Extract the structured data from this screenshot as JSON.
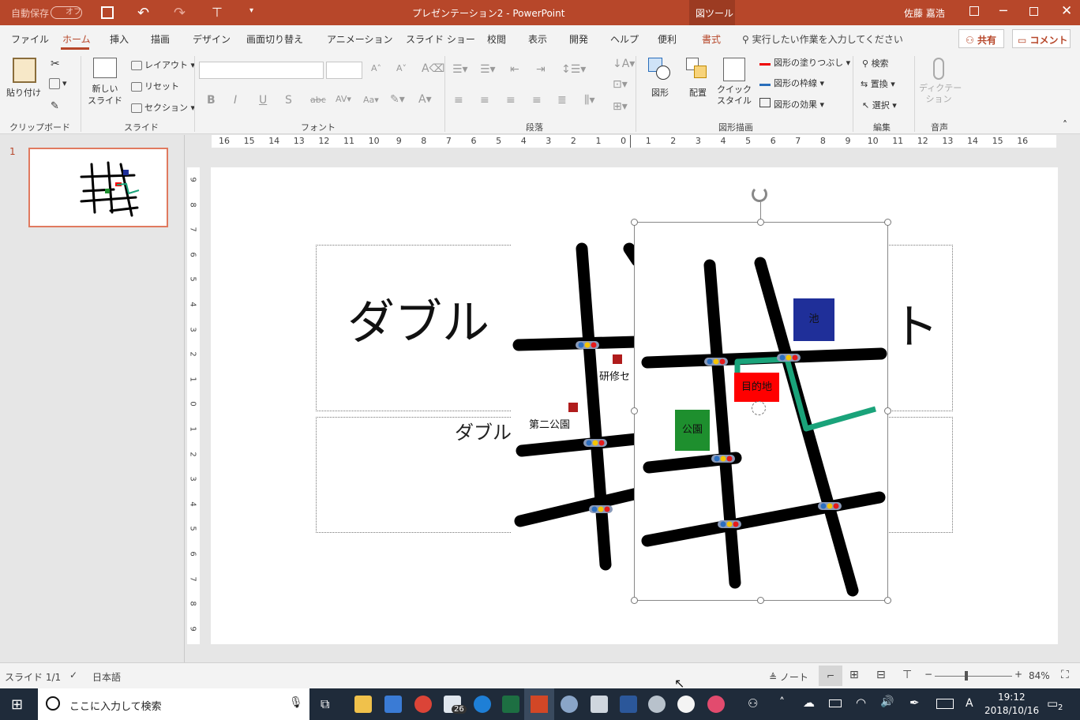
{
  "titlebar": {
    "autosave_label": "自動保存",
    "autosave_state": "オフ",
    "doc_title": "プレゼンテーション2 - PowerPoint",
    "context_tab": "図ツール",
    "user": "佐藤 嘉浩"
  },
  "tabs": [
    "ファイル",
    "ホーム",
    "挿入",
    "描画",
    "デザイン",
    "画面切り替え",
    "アニメーション",
    "スライド ショー",
    "校閲",
    "表示",
    "開発",
    "ヘルプ",
    "便利",
    "書式"
  ],
  "tell_me": "実行したい作業を入力してください",
  "share": "共有",
  "comment": "コメント",
  "ribbon": {
    "paste": "貼り付け",
    "new_slide": "新しい\nスライド",
    "layout": "レイアウト",
    "reset": "リセット",
    "section": "セクション",
    "shapes": "図形",
    "arrange": "配置",
    "quick_style": "クイック\nスタイル",
    "fill": "図形の塗りつぶし",
    "outline": "図形の枠線",
    "effects": "図形の効果",
    "find": "検索",
    "replace": "置換",
    "select": "選択",
    "dictate": "ディクテー\nション",
    "groups": [
      "クリップボード",
      "スライド",
      "フォント",
      "段落",
      "図形描画",
      "編集",
      "音声"
    ]
  },
  "ruler_h": [
    "16",
    "15",
    "14",
    "13",
    "12",
    "11",
    "10",
    "9",
    "8",
    "7",
    "6",
    "5",
    "4",
    "3",
    "2",
    "1",
    "0",
    "1",
    "2",
    "3",
    "4",
    "5",
    "6",
    "7",
    "8",
    "9",
    "10",
    "11",
    "12",
    "13",
    "14",
    "15",
    "16"
  ],
  "ruler_v": [
    "9",
    "8",
    "7",
    "6",
    "5",
    "4",
    "3",
    "2",
    "1",
    "0",
    "1",
    "2",
    "3",
    "4",
    "5",
    "6",
    "7",
    "8",
    "9"
  ],
  "thumb_number": "1",
  "slide": {
    "title_start": "ダブル",
    "title_end": "ト",
    "subtitle_start": "ダブル",
    "map_back": {
      "label_kenshu": "研修セ",
      "label_park2": "第二公園"
    },
    "map_front": {
      "pond": "池",
      "dest": "目的地",
      "park": "公園"
    }
  },
  "status": {
    "slide_of": "スライド 1/1",
    "lang": "日本語",
    "notes": "ノート",
    "zoom": "84%"
  },
  "taskbar": {
    "search": "ここに入力して検索",
    "mail_badge": "26",
    "time": "19:12",
    "date": "2018/10/16",
    "ime": "A",
    "notif": "2"
  },
  "colors": {
    "ppt_accent": "#b7472a",
    "pond": "#1f2f99",
    "dest": "#ff0000",
    "park": "#1e8f2e",
    "route": "#1aa37a"
  }
}
